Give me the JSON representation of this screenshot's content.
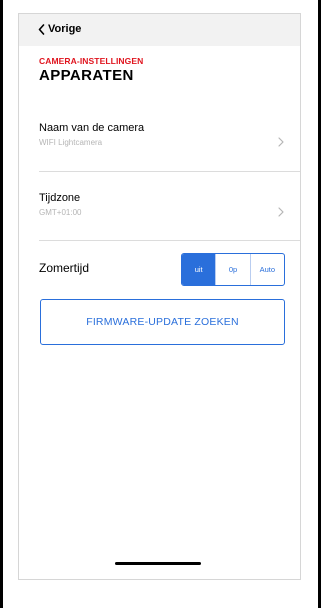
{
  "nav": {
    "back_label": "Vorige",
    "back_icon": "chevron-left-icon"
  },
  "header": {
    "subtitle": "CAMERA-INSTELLINGEN",
    "title": "APPARATEN",
    "subtitle_color": "#e0141e"
  },
  "settings": [
    {
      "label": "Naam van de camera",
      "value": "WIFI Lightcamera",
      "icon": "chevron-right-icon"
    },
    {
      "label": "Tijdzone",
      "value": "GMT+01:00",
      "icon": "chevron-right-icon"
    }
  ],
  "dst": {
    "label": "Zomertijd",
    "options": [
      "uit",
      "0p",
      "Auto"
    ],
    "selected": "uit"
  },
  "firmware_button": {
    "label": "FIRMWARE-UPDATE ZOEKEN"
  },
  "colors": {
    "accent": "#2a6fdb",
    "nav_background": "#f2f2f2"
  }
}
